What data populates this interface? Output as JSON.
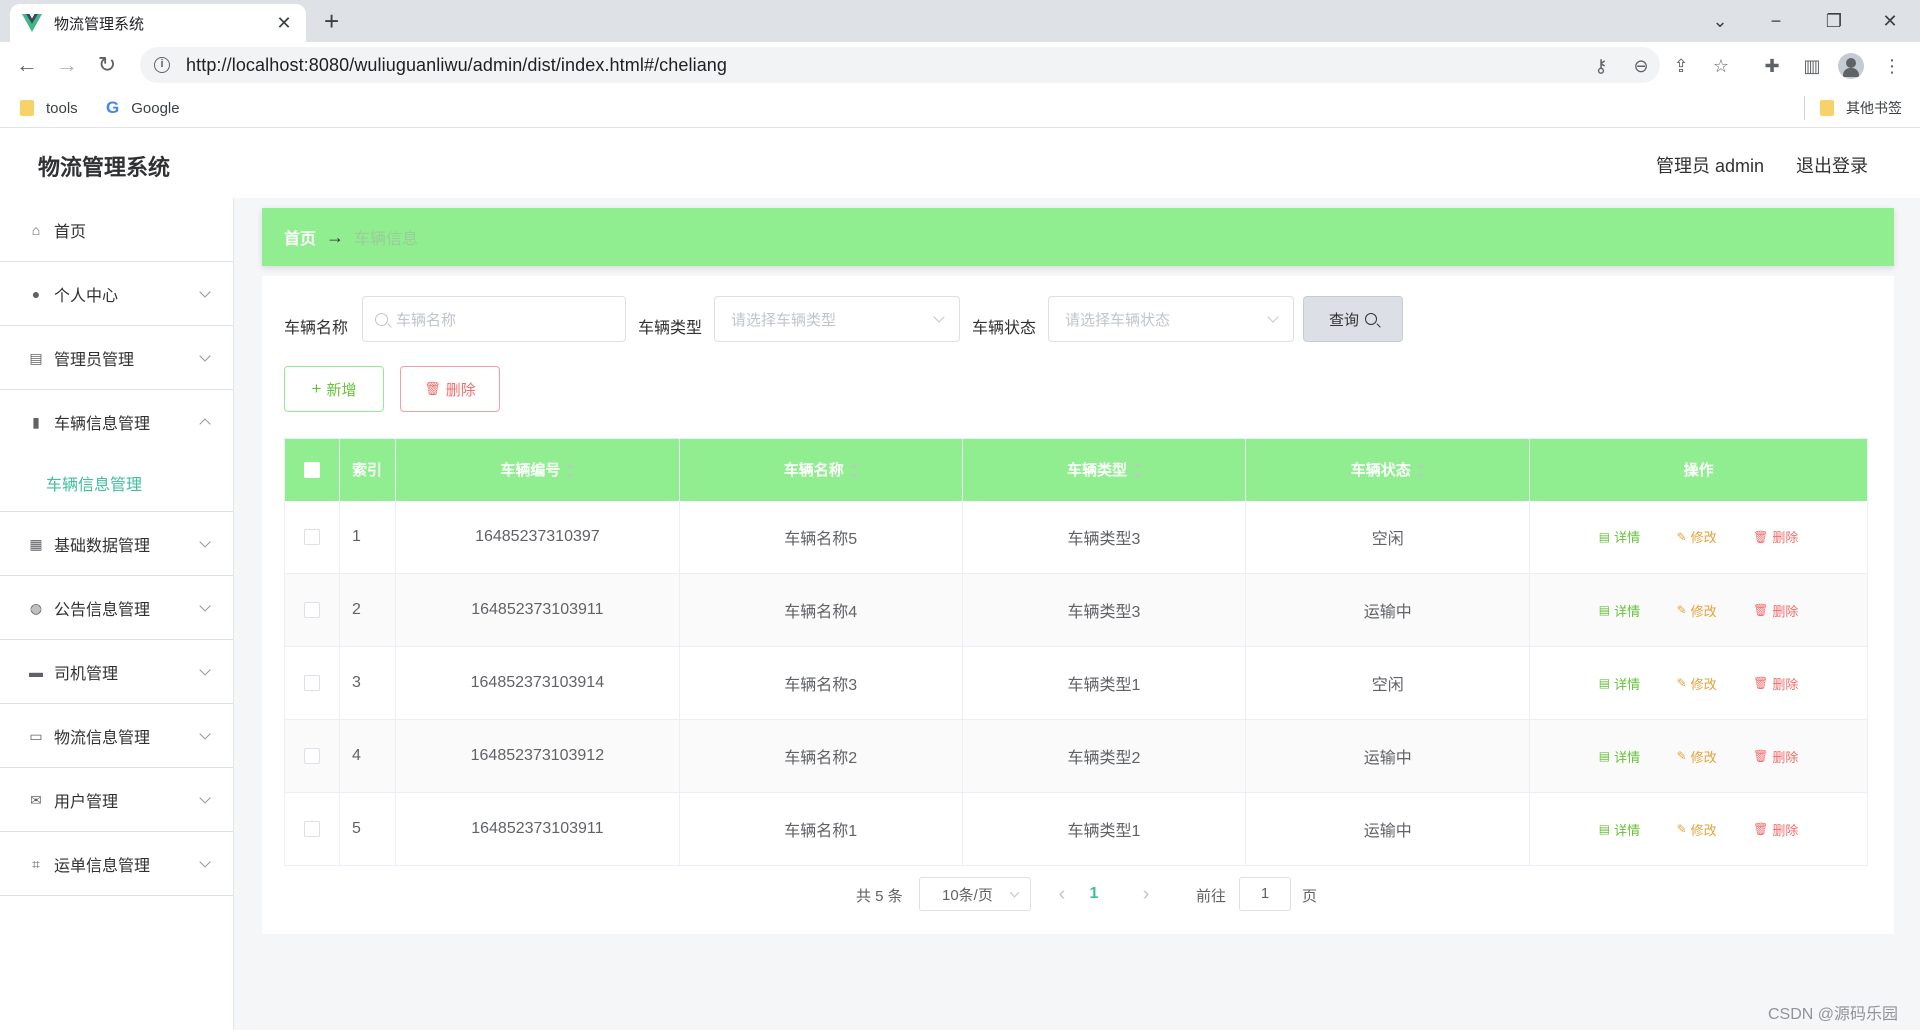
{
  "browser": {
    "tab_title": "物流管理系统",
    "url": "http://localhost:8080/wuliuguanliwu/admin/dist/index.html#/cheliang",
    "bookmarks": [
      {
        "label": "tools"
      },
      {
        "label": "Google"
      }
    ],
    "other_bookmarks": "其他书签"
  },
  "app": {
    "title": "物流管理系统",
    "user": "管理员 admin",
    "logout": "退出登录"
  },
  "sidebar": {
    "items": [
      {
        "label": "首页",
        "icon": "home-icon"
      },
      {
        "label": "个人中心",
        "icon": "user-icon"
      },
      {
        "label": "管理员管理",
        "icon": "chat-icon"
      },
      {
        "label": "车辆信息管理",
        "icon": "clipboard-icon",
        "expanded": true
      },
      {
        "label": "基础数据管理",
        "icon": "grid-icon"
      },
      {
        "label": "公告信息管理",
        "icon": "pin-icon"
      },
      {
        "label": "司机管理",
        "icon": "printer-icon"
      },
      {
        "label": "物流信息管理",
        "icon": "message-icon"
      },
      {
        "label": "用户管理",
        "icon": "mail-icon"
      },
      {
        "label": "运单信息管理",
        "icon": "crop-icon"
      }
    ],
    "submenu_active": "车辆信息管理"
  },
  "breadcrumb": {
    "home": "首页",
    "arrow": "→",
    "current": "车辆信息"
  },
  "filters": {
    "name_label": "车辆名称",
    "name_placeholder": "车辆名称",
    "type_label": "车辆类型",
    "type_placeholder": "请选择车辆类型",
    "status_label": "车辆状态",
    "status_placeholder": "请选择车辆状态",
    "query_label": "查询"
  },
  "actions": {
    "add_label": "新增",
    "delete_label": "删除"
  },
  "table": {
    "headers": {
      "index": "索引",
      "number": "车辆编号",
      "name": "车辆名称",
      "type": "车辆类型",
      "status": "车辆状态",
      "ops": "操作"
    },
    "op_labels": {
      "detail": "详情",
      "edit": "修改",
      "remove": "删除"
    },
    "rows": [
      {
        "index": "1",
        "number": "16485237310397",
        "name": "车辆名称5",
        "type": "车辆类型3",
        "status": "空闲"
      },
      {
        "index": "2",
        "number": "164852373103911",
        "name": "车辆名称4",
        "type": "车辆类型3",
        "status": "运输中"
      },
      {
        "index": "3",
        "number": "164852373103914",
        "name": "车辆名称3",
        "type": "车辆类型1",
        "status": "空闲"
      },
      {
        "index": "4",
        "number": "164852373103912",
        "name": "车辆名称2",
        "type": "车辆类型2",
        "status": "运输中"
      },
      {
        "index": "5",
        "number": "164852373103911",
        "name": "车辆名称1",
        "type": "车辆类型1",
        "status": "运输中"
      }
    ]
  },
  "pagination": {
    "total": "共 5 条",
    "page_size": "10条/页",
    "current_page": "1",
    "goto_prefix": "前往",
    "goto_value": "1",
    "goto_suffix": "页"
  },
  "watermark": "CSDN @源码乐园",
  "colors": {
    "accent_green": "#90ee90",
    "active_teal": "#3ebfa0",
    "detail_green": "#67c23a",
    "edit_orange": "#e6a23c",
    "delete_red": "#f56c6c"
  }
}
